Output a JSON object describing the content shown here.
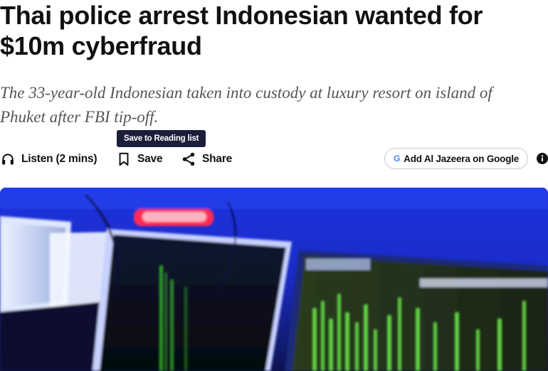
{
  "article": {
    "headline": "Thai police arrest Indonesian wanted for $10m cyberfraud",
    "subheadline": "The 33-year-old Indonesian taken into custody at luxury resort on island of Phuket after FBI tip-off."
  },
  "toolbar": {
    "tooltip": "Save to Reading list",
    "listen_label": "Listen (2 mins)",
    "save_label": "Save",
    "share_label": "Share",
    "google_label": "Add Al Jazeera on Google",
    "google_glyph": "G",
    "icons": {
      "listen": "headphones-icon",
      "save": "bookmark-icon",
      "share": "share-icon",
      "google": "google-g-icon",
      "info": "info-icon"
    }
  },
  "hero_image": {
    "description": "Blurred blue-lit control room monitors displaying green signal graphs"
  }
}
